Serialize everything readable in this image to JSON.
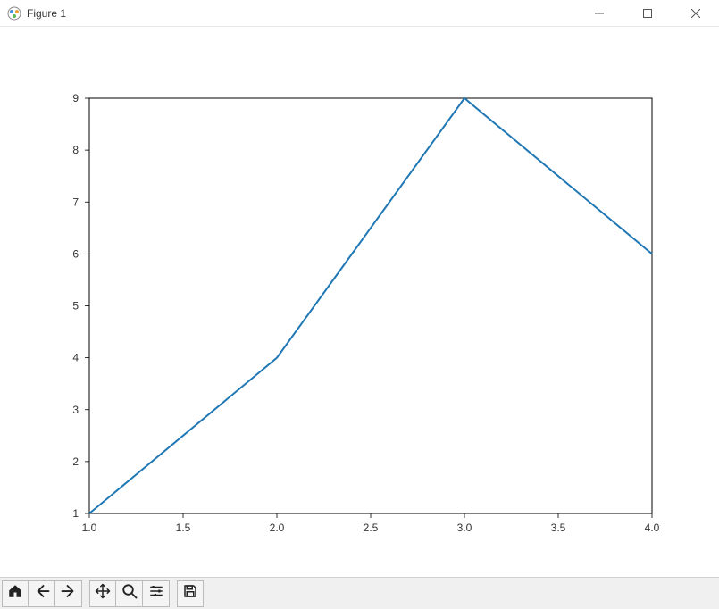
{
  "window": {
    "title": "Figure 1"
  },
  "chart_data": {
    "type": "line",
    "x": [
      1,
      2,
      3,
      4
    ],
    "values": [
      1,
      4,
      9,
      6
    ],
    "title": "",
    "xlabel": "",
    "ylabel": "",
    "xlim": [
      1.0,
      4.0
    ],
    "ylim": [
      1,
      9
    ],
    "xticks": [
      "1.0",
      "1.5",
      "2.0",
      "2.5",
      "3.0",
      "3.5",
      "4.0"
    ],
    "yticks": [
      "1",
      "2",
      "3",
      "4",
      "5",
      "6",
      "7",
      "8",
      "9"
    ],
    "line_color": "#1f77b4"
  },
  "toolbar": {
    "home": "Home",
    "back": "Back",
    "forward": "Forward",
    "pan": "Pan",
    "zoom": "Zoom",
    "configure": "Configure subplots",
    "save": "Save"
  },
  "window_controls": {
    "minimize": "Minimize",
    "maximize": "Maximize",
    "close": "Close"
  }
}
